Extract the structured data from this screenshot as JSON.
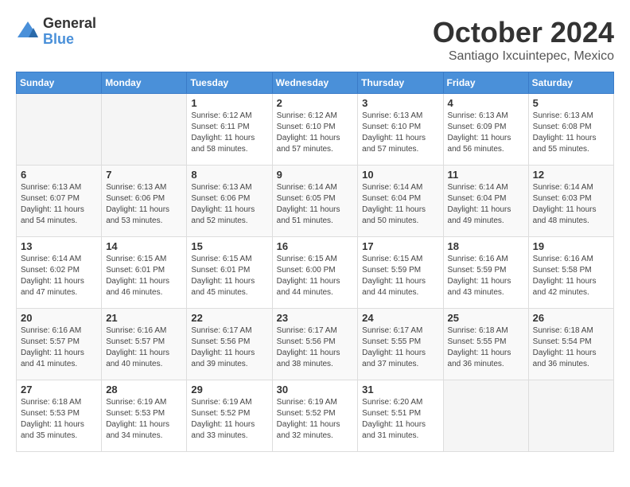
{
  "logo": {
    "general": "General",
    "blue": "Blue"
  },
  "title": "October 2024",
  "location": "Santiago Ixcuintepec, Mexico",
  "days_of_week": [
    "Sunday",
    "Monday",
    "Tuesday",
    "Wednesday",
    "Thursday",
    "Friday",
    "Saturday"
  ],
  "weeks": [
    [
      {
        "day": "",
        "info": ""
      },
      {
        "day": "",
        "info": ""
      },
      {
        "day": "1",
        "info": "Sunrise: 6:12 AM\nSunset: 6:11 PM\nDaylight: 11 hours and 58 minutes."
      },
      {
        "day": "2",
        "info": "Sunrise: 6:12 AM\nSunset: 6:10 PM\nDaylight: 11 hours and 57 minutes."
      },
      {
        "day": "3",
        "info": "Sunrise: 6:13 AM\nSunset: 6:10 PM\nDaylight: 11 hours and 57 minutes."
      },
      {
        "day": "4",
        "info": "Sunrise: 6:13 AM\nSunset: 6:09 PM\nDaylight: 11 hours and 56 minutes."
      },
      {
        "day": "5",
        "info": "Sunrise: 6:13 AM\nSunset: 6:08 PM\nDaylight: 11 hours and 55 minutes."
      }
    ],
    [
      {
        "day": "6",
        "info": "Sunrise: 6:13 AM\nSunset: 6:07 PM\nDaylight: 11 hours and 54 minutes."
      },
      {
        "day": "7",
        "info": "Sunrise: 6:13 AM\nSunset: 6:06 PM\nDaylight: 11 hours and 53 minutes."
      },
      {
        "day": "8",
        "info": "Sunrise: 6:13 AM\nSunset: 6:06 PM\nDaylight: 11 hours and 52 minutes."
      },
      {
        "day": "9",
        "info": "Sunrise: 6:14 AM\nSunset: 6:05 PM\nDaylight: 11 hours and 51 minutes."
      },
      {
        "day": "10",
        "info": "Sunrise: 6:14 AM\nSunset: 6:04 PM\nDaylight: 11 hours and 50 minutes."
      },
      {
        "day": "11",
        "info": "Sunrise: 6:14 AM\nSunset: 6:04 PM\nDaylight: 11 hours and 49 minutes."
      },
      {
        "day": "12",
        "info": "Sunrise: 6:14 AM\nSunset: 6:03 PM\nDaylight: 11 hours and 48 minutes."
      }
    ],
    [
      {
        "day": "13",
        "info": "Sunrise: 6:14 AM\nSunset: 6:02 PM\nDaylight: 11 hours and 47 minutes."
      },
      {
        "day": "14",
        "info": "Sunrise: 6:15 AM\nSunset: 6:01 PM\nDaylight: 11 hours and 46 minutes."
      },
      {
        "day": "15",
        "info": "Sunrise: 6:15 AM\nSunset: 6:01 PM\nDaylight: 11 hours and 45 minutes."
      },
      {
        "day": "16",
        "info": "Sunrise: 6:15 AM\nSunset: 6:00 PM\nDaylight: 11 hours and 44 minutes."
      },
      {
        "day": "17",
        "info": "Sunrise: 6:15 AM\nSunset: 5:59 PM\nDaylight: 11 hours and 44 minutes."
      },
      {
        "day": "18",
        "info": "Sunrise: 6:16 AM\nSunset: 5:59 PM\nDaylight: 11 hours and 43 minutes."
      },
      {
        "day": "19",
        "info": "Sunrise: 6:16 AM\nSunset: 5:58 PM\nDaylight: 11 hours and 42 minutes."
      }
    ],
    [
      {
        "day": "20",
        "info": "Sunrise: 6:16 AM\nSunset: 5:57 PM\nDaylight: 11 hours and 41 minutes."
      },
      {
        "day": "21",
        "info": "Sunrise: 6:16 AM\nSunset: 5:57 PM\nDaylight: 11 hours and 40 minutes."
      },
      {
        "day": "22",
        "info": "Sunrise: 6:17 AM\nSunset: 5:56 PM\nDaylight: 11 hours and 39 minutes."
      },
      {
        "day": "23",
        "info": "Sunrise: 6:17 AM\nSunset: 5:56 PM\nDaylight: 11 hours and 38 minutes."
      },
      {
        "day": "24",
        "info": "Sunrise: 6:17 AM\nSunset: 5:55 PM\nDaylight: 11 hours and 37 minutes."
      },
      {
        "day": "25",
        "info": "Sunrise: 6:18 AM\nSunset: 5:55 PM\nDaylight: 11 hours and 36 minutes."
      },
      {
        "day": "26",
        "info": "Sunrise: 6:18 AM\nSunset: 5:54 PM\nDaylight: 11 hours and 36 minutes."
      }
    ],
    [
      {
        "day": "27",
        "info": "Sunrise: 6:18 AM\nSunset: 5:53 PM\nDaylight: 11 hours and 35 minutes."
      },
      {
        "day": "28",
        "info": "Sunrise: 6:19 AM\nSunset: 5:53 PM\nDaylight: 11 hours and 34 minutes."
      },
      {
        "day": "29",
        "info": "Sunrise: 6:19 AM\nSunset: 5:52 PM\nDaylight: 11 hours and 33 minutes."
      },
      {
        "day": "30",
        "info": "Sunrise: 6:19 AM\nSunset: 5:52 PM\nDaylight: 11 hours and 32 minutes."
      },
      {
        "day": "31",
        "info": "Sunrise: 6:20 AM\nSunset: 5:51 PM\nDaylight: 11 hours and 31 minutes."
      },
      {
        "day": "",
        "info": ""
      },
      {
        "day": "",
        "info": ""
      }
    ]
  ]
}
